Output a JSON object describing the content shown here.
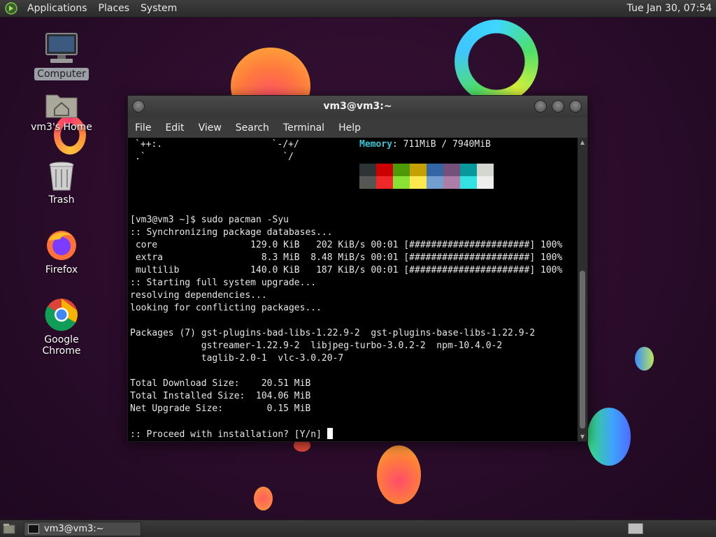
{
  "top_panel": {
    "menus": [
      "Applications",
      "Places",
      "System"
    ],
    "clock": "Tue Jan 30, 07:54"
  },
  "desktop_icons": [
    {
      "label": "Computer"
    },
    {
      "label": "vm3's Home"
    },
    {
      "label": "Trash"
    },
    {
      "label": "Firefox"
    },
    {
      "label": "Google Chrome"
    }
  ],
  "terminal": {
    "title": "vm3@vm3:~",
    "menus": [
      "File",
      "Edit",
      "View",
      "Search",
      "Terminal",
      "Help"
    ],
    "neofetch_art_1": "`++:.                    `-/+/",
    "neofetch_art_2": ".`                         `/",
    "memory_label": "Memory",
    "memory_value": ": 711MiB / 7940MiB",
    "palette_colors": [
      "#2e3436",
      "#cc0000",
      "#4e9a06",
      "#c4a000",
      "#3465a4",
      "#75507b",
      "#06989a",
      "#d3d7cf",
      "#555753",
      "#ef2929",
      "#8ae234",
      "#fce94f",
      "#729fcf",
      "#ad7fa8",
      "#34e2e2",
      "#eeeeec"
    ],
    "lines": [
      "[vm3@vm3 ~]$ sudo pacman -Syu",
      ":: Synchronizing package databases...",
      " core                 129.0 KiB   202 KiB/s 00:01 [######################] 100%",
      " extra                  8.3 MiB  8.48 MiB/s 00:01 [######################] 100%",
      " multilib             140.0 KiB   187 KiB/s 00:01 [######################] 100%",
      ":: Starting full system upgrade...",
      "resolving dependencies...",
      "looking for conflicting packages...",
      "",
      "Packages (7) gst-plugins-bad-libs-1.22.9-2  gst-plugins-base-libs-1.22.9-2",
      "             gstreamer-1.22.9-2  libjpeg-turbo-3.0.2-2  npm-10.4.0-2",
      "             taglib-2.0-1  vlc-3.0.20-7",
      "",
      "Total Download Size:    20.51 MiB",
      "Total Installed Size:  104.06 MiB",
      "Net Upgrade Size:        0.15 MiB",
      "",
      ":: Proceed with installation? [Y/n] "
    ]
  },
  "taskbar": {
    "task_label": "vm3@vm3:~"
  }
}
